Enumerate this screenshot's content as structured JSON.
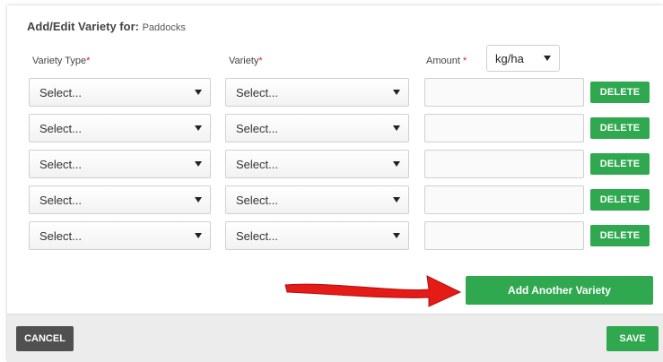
{
  "dialog": {
    "title": "Add/Edit Variety for:",
    "subject": "Paddocks"
  },
  "columns": {
    "variety_type": "Variety Type",
    "variety": "Variety",
    "amount": "Amount",
    "required_mark": "*"
  },
  "unit": {
    "selected": "kg/ha"
  },
  "rows": [
    {
      "variety_type": "Select...",
      "variety": "Select...",
      "amount": "",
      "delete_label": "DELETE"
    },
    {
      "variety_type": "Select...",
      "variety": "Select...",
      "amount": "",
      "delete_label": "DELETE"
    },
    {
      "variety_type": "Select...",
      "variety": "Select...",
      "amount": "",
      "delete_label": "DELETE"
    },
    {
      "variety_type": "Select...",
      "variety": "Select...",
      "amount": "",
      "delete_label": "DELETE"
    },
    {
      "variety_type": "Select...",
      "variety": "Select...",
      "amount": "",
      "delete_label": "DELETE"
    }
  ],
  "actions": {
    "add_label": "Add Another Variety",
    "cancel_label": "CANCEL",
    "save_label": "SAVE"
  },
  "annotation": {
    "icon": "red-arrow-icon",
    "color": "#e41b17"
  },
  "colors": {
    "primary": "#2fa84f",
    "cancel": "#505050",
    "required": "#e02020"
  }
}
